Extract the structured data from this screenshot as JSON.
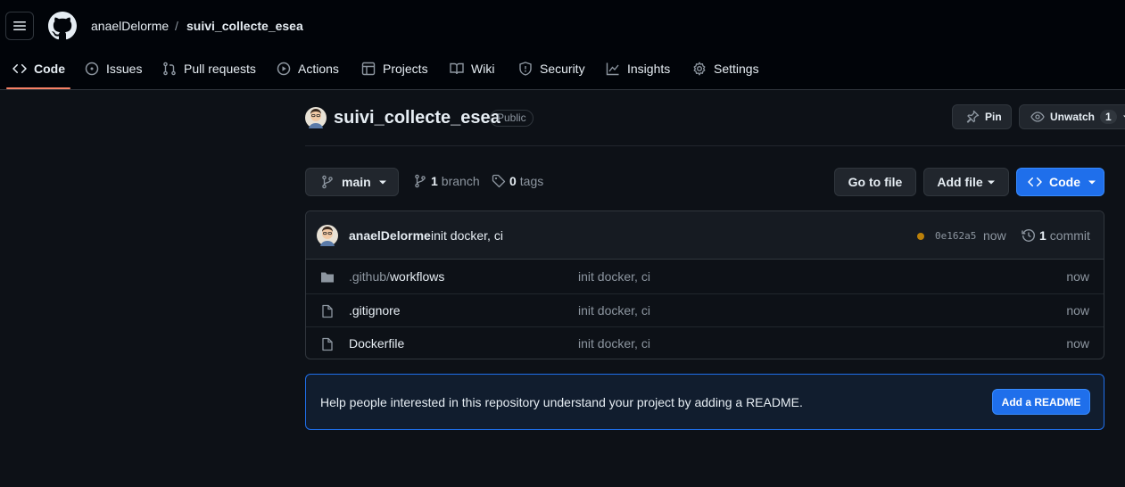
{
  "header": {
    "owner": "anaelDelorme",
    "separator": "/",
    "repo": "suivi_collecte_esea"
  },
  "nav": {
    "code": "Code",
    "issues": "Issues",
    "pull_requests": "Pull requests",
    "actions": "Actions",
    "projects": "Projects",
    "wiki": "Wiki",
    "security": "Security",
    "insights": "Insights",
    "settings": "Settings"
  },
  "repo": {
    "name": "suivi_collecte_esea",
    "visibility": "Public",
    "pin_label": "Pin",
    "unwatch_label": "Unwatch",
    "watch_count": "1"
  },
  "toolbar": {
    "branch": "main",
    "branch_count": "1",
    "branch_label": "branch",
    "tag_count": "0",
    "tag_label": "tags",
    "go_to_file": "Go to file",
    "add_file": "Add file",
    "code": "Code"
  },
  "commit": {
    "author": "anaelDelorme",
    "message": "init docker, ci",
    "sha": "0e162a5",
    "age": "now",
    "commit_count": "1",
    "commit_label": "commit",
    "status_color": "#bb8009"
  },
  "files": [
    {
      "type": "dir",
      "prefix": ".github/",
      "name": "workflows",
      "message": "init docker, ci",
      "age": "now"
    },
    {
      "type": "file",
      "prefix": "",
      "name": ".gitignore",
      "message": "init docker, ci",
      "age": "now"
    },
    {
      "type": "file",
      "prefix": "",
      "name": "Dockerfile",
      "message": "init docker, ci",
      "age": "now"
    }
  ],
  "readme": {
    "text": "Help people interested in this repository understand your project by adding a README.",
    "button": "Add a README"
  },
  "colors": {
    "accent": "#1f6feb",
    "underline": "#f78166",
    "background": "#0d1117"
  }
}
